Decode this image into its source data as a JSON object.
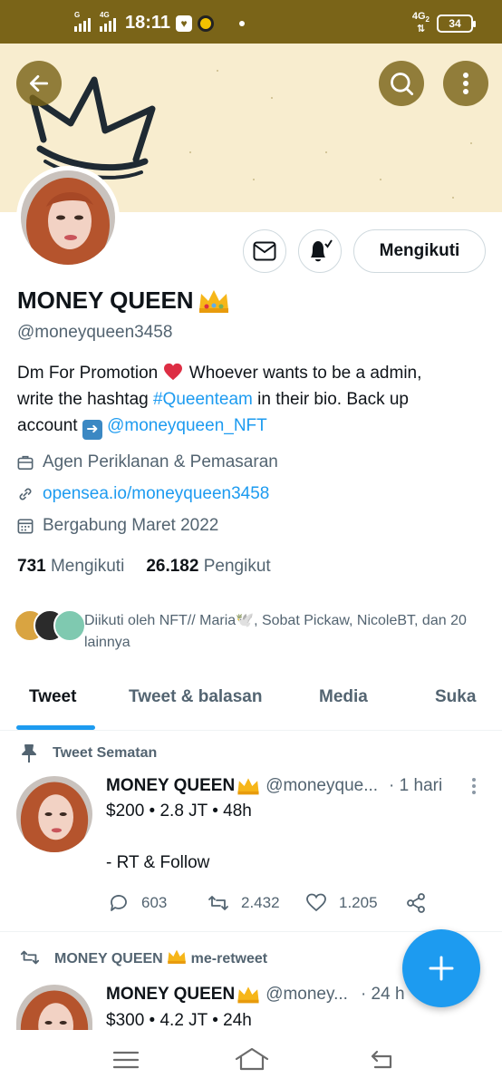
{
  "status_bar": {
    "time": "18:11",
    "signal1_tag": "G",
    "signal2_tag": "4G",
    "network": "4G",
    "network_sub": "2",
    "battery": "34"
  },
  "profile": {
    "name": "MONEY QUEEN",
    "name_emoji": "crown-emoji",
    "handle": "@moneyqueen3458",
    "follow_button": "Mengikuti",
    "bio": {
      "line1_a": "Dm For Promotion",
      "line1_b": " Whoever wants to be a admin,",
      "line2_a": "write the hashtag ",
      "hashtag": "#Queenteam",
      "line2_b": " in their bio.  Back up",
      "line3_a": "account ",
      "mention": "@moneyqueen_NFT"
    },
    "category": "Agen Periklanan & Pemasaran",
    "website": "opensea.io/moneyqueen3458",
    "joined": "Bergabung Maret 2022",
    "following_count": "731",
    "following_label": "Mengikuti",
    "followers_count": "26.182",
    "followers_label": "Pengikut",
    "followed_by": "Diikuti oleh NFT// Maria🕊️, Sobat Pickaw, NicoleBT, dan 20 lainnya"
  },
  "tabs": [
    "Tweet",
    "Tweet & balasan",
    "Media",
    "Suka"
  ],
  "pinned_label": "Tweet Sematan",
  "tweets": [
    {
      "name": "MONEY QUEEN",
      "handle": "@moneyque...",
      "time": "· 1 hari",
      "line1": "$200 • 2.8 JT • 48h",
      "line2": "- RT & Follow",
      "replies": "603",
      "retweets": "2.432",
      "likes": "1.205"
    },
    {
      "retweet_label": "MONEY QUEEN",
      "retweet_suffix": "me-retweet",
      "name": "MONEY QUEEN",
      "handle": "@money...",
      "time": "· 24 h",
      "line1": "$300 • 4.2 JT • 24h"
    }
  ],
  "colors": {
    "status_bar": "#7a6418",
    "banner": "#f8edcf",
    "accent": "#1d9bf0",
    "muted": "#536471",
    "heart": "#e0245e"
  }
}
